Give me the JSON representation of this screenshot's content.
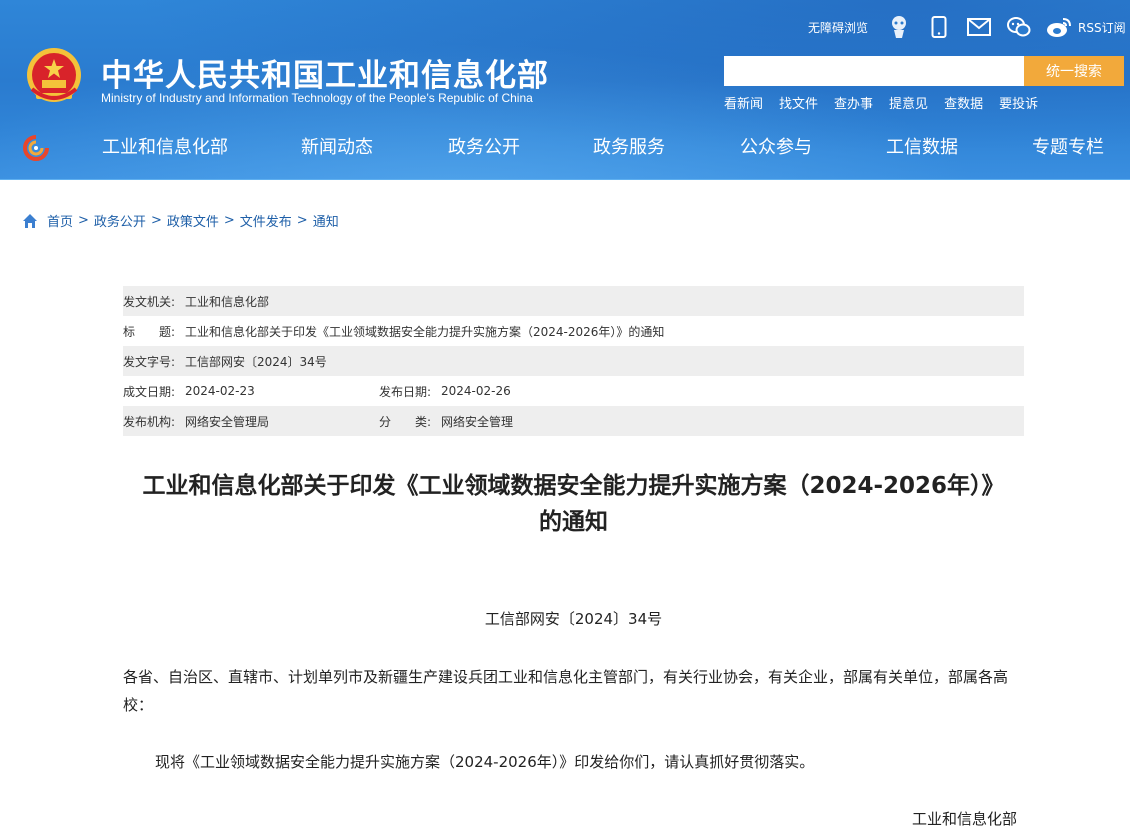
{
  "header": {
    "title_cn": "中华人民共和国工业和信息化部",
    "title_en": "Ministry of Industry and Information Technology of the People’s Republic of China",
    "accessibility": "无障碍浏览",
    "rss": "RSS订阅",
    "icons": [
      "robot-icon",
      "mobile-icon",
      "mail-icon",
      "wechat-icon",
      "weibo-icon"
    ],
    "search": {
      "placeholder": "",
      "button": "统一搜索"
    },
    "quick_links": [
      "看新闻",
      "找文件",
      "查办事",
      "提意见",
      "查数据",
      "要投诉"
    ],
    "nav": [
      "工业和信息化部",
      "新闻动态",
      "政务公开",
      "政务服务",
      "公众参与",
      "工信数据",
      "专题专栏"
    ],
    "colors": {
      "bar": "#2f86d8",
      "search_button": "#f2a93b"
    }
  },
  "breadcrumb": [
    "首页",
    "政务公开",
    "政策文件",
    "文件发布",
    "通知"
  ],
  "info": {
    "issuer_label": "发文机关:",
    "issuer": "工业和信息化部",
    "title_label": "标　　题:",
    "title": "工业和信息化部关于印发《工业领域数据安全能力提升实施方案（2024-2026年）》的通知",
    "docno_label": "发文字号:",
    "docno": "工信部网安〔2024〕34号",
    "created_label": "成文日期:",
    "created": "2024-02-23",
    "published_label": "发布日期:",
    "published": "2024-02-26",
    "org_label": "发布机构:",
    "org": "网络安全管理局",
    "category_label": "分　　类:",
    "category": "网络安全管理"
  },
  "article": {
    "title_line1": "工业和信息化部关于印发《工业领域数据安全能力提升实施方案（2024-2026年）》",
    "title_line2": "的通知",
    "doc_no": "工信部网安〔2024〕34号",
    "para1": "各省、自治区、直辖市、计划单列市及新疆生产建设兵团工业和信息化主管部门，有关行业协会，有关企业，部属有关单位，部属各高校：",
    "para2": "现将《工业领域数据安全能力提升实施方案（2024-2026年）》印发给你们，请认真抓好贯彻落实。",
    "signature": "工业和信息化部"
  }
}
